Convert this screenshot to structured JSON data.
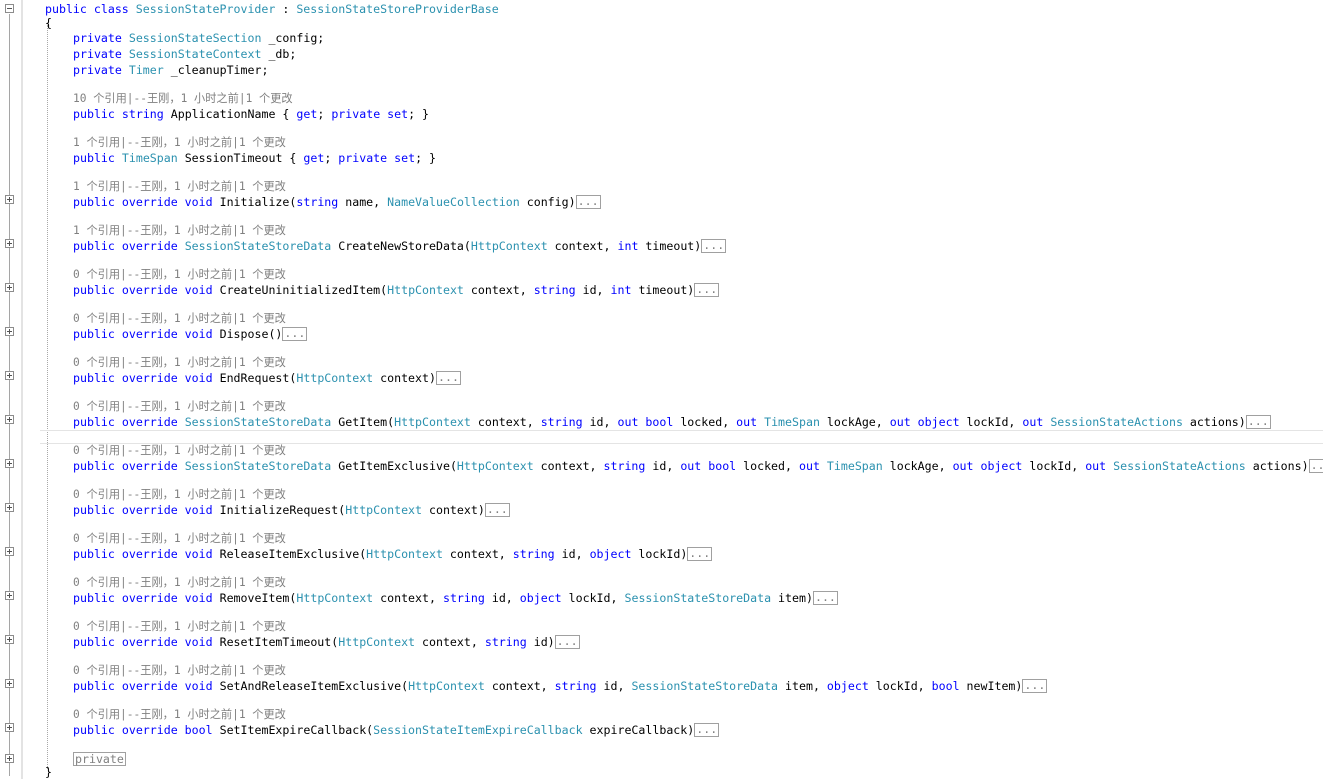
{
  "code": {
    "class_decl": {
      "kw1": "public",
      "kw2": "class",
      "name": "SessionStateProvider",
      "sep": " : ",
      "base": "SessionStateStoreProviderBase"
    },
    "open_brace": "{",
    "close_brace": "}",
    "fields": [
      {
        "kw": "private",
        "type": "SessionStateSection",
        "name": " _config;"
      },
      {
        "kw": "private",
        "type": "SessionStateContext",
        "name": " _db;"
      },
      {
        "kw": "private",
        "type": "Timer",
        "name": " _cleanupTimer;"
      }
    ],
    "lens": {
      "sep1": " 个引用|--",
      "author": "王刚",
      "comma": "，",
      "time": "1 小时之前",
      "bar": "|",
      "changes": "1 个更改"
    },
    "members": [
      {
        "refs": "10",
        "sig": [
          [
            "kw",
            "public "
          ],
          [
            "kw",
            "string"
          ],
          [
            "t",
            " ApplicationName { "
          ],
          [
            "kw",
            "get"
          ],
          [
            "t",
            "; "
          ],
          [
            "kw",
            "private set"
          ],
          [
            "t",
            "; }"
          ]
        ],
        "collapsed": false
      },
      {
        "refs": "1",
        "sig": [
          [
            "kw",
            "public "
          ],
          [
            "ty",
            "TimeSpan"
          ],
          [
            "t",
            " SessionTimeout { "
          ],
          [
            "kw",
            "get"
          ],
          [
            "t",
            "; "
          ],
          [
            "kw",
            "private set"
          ],
          [
            "t",
            "; }"
          ]
        ],
        "collapsed": false
      },
      {
        "refs": "1",
        "sig": [
          [
            "kw",
            "public override void"
          ],
          [
            "t",
            " Initialize("
          ],
          [
            "kw",
            "string"
          ],
          [
            "t",
            " name, "
          ],
          [
            "ty",
            "NameValueCollection"
          ],
          [
            "t",
            " config)"
          ]
        ],
        "collapsed": true
      },
      {
        "refs": "1",
        "sig": [
          [
            "kw",
            "public override "
          ],
          [
            "ty",
            "SessionStateStoreData"
          ],
          [
            "t",
            " CreateNewStoreData("
          ],
          [
            "ty",
            "HttpContext"
          ],
          [
            "t",
            " context, "
          ],
          [
            "kw",
            "int"
          ],
          [
            "t",
            " timeout)"
          ]
        ],
        "collapsed": true
      },
      {
        "refs": "0",
        "sig": [
          [
            "kw",
            "public override void"
          ],
          [
            "t",
            " CreateUninitializedItem("
          ],
          [
            "ty",
            "HttpContext"
          ],
          [
            "t",
            " context, "
          ],
          [
            "kw",
            "string"
          ],
          [
            "t",
            " id, "
          ],
          [
            "kw",
            "int"
          ],
          [
            "t",
            " timeout)"
          ]
        ],
        "collapsed": true
      },
      {
        "refs": "0",
        "sig": [
          [
            "kw",
            "public override void"
          ],
          [
            "t",
            " Dispose()"
          ]
        ],
        "collapsed": true
      },
      {
        "refs": "0",
        "sig": [
          [
            "kw",
            "public override void"
          ],
          [
            "t",
            " EndRequest("
          ],
          [
            "ty",
            "HttpContext"
          ],
          [
            "t",
            " context)"
          ]
        ],
        "collapsed": true
      },
      {
        "refs": "0",
        "sig": [
          [
            "kw",
            "public override "
          ],
          [
            "ty",
            "SessionStateStoreData"
          ],
          [
            "t",
            " GetItem("
          ],
          [
            "ty",
            "HttpContext"
          ],
          [
            "t",
            " context, "
          ],
          [
            "kw",
            "string"
          ],
          [
            "t",
            " id, "
          ],
          [
            "kw",
            "out bool"
          ],
          [
            "t",
            " locked, "
          ],
          [
            "kw",
            "out "
          ],
          [
            "ty",
            "TimeSpan"
          ],
          [
            "t",
            " lockAge, "
          ],
          [
            "kw",
            "out object"
          ],
          [
            "t",
            " lockId, "
          ],
          [
            "kw",
            "out "
          ],
          [
            "ty",
            "SessionStateActions"
          ],
          [
            "t",
            " actions)"
          ]
        ],
        "collapsed": true
      },
      {
        "refs": "0",
        "sig": [
          [
            "kw",
            "public override "
          ],
          [
            "ty",
            "SessionStateStoreData"
          ],
          [
            "t",
            " GetItemExclusive("
          ],
          [
            "ty",
            "HttpContext"
          ],
          [
            "t",
            " context, "
          ],
          [
            "kw",
            "string"
          ],
          [
            "t",
            " id, "
          ],
          [
            "kw",
            "out bool"
          ],
          [
            "t",
            " locked, "
          ],
          [
            "kw",
            "out "
          ],
          [
            "ty",
            "TimeSpan"
          ],
          [
            "t",
            " lockAge, "
          ],
          [
            "kw",
            "out object"
          ],
          [
            "t",
            " lockId, "
          ],
          [
            "kw",
            "out "
          ],
          [
            "ty",
            "SessionStateActions"
          ],
          [
            "t",
            " actions)"
          ]
        ],
        "collapsed": true
      },
      {
        "refs": "0",
        "sig": [
          [
            "kw",
            "public override void"
          ],
          [
            "t",
            " InitializeRequest("
          ],
          [
            "ty",
            "HttpContext"
          ],
          [
            "t",
            " context)"
          ]
        ],
        "collapsed": true
      },
      {
        "refs": "0",
        "sig": [
          [
            "kw",
            "public override void"
          ],
          [
            "t",
            " ReleaseItemExclusive("
          ],
          [
            "ty",
            "HttpContext"
          ],
          [
            "t",
            " context, "
          ],
          [
            "kw",
            "string"
          ],
          [
            "t",
            " id, "
          ],
          [
            "kw",
            "object"
          ],
          [
            "t",
            " lockId)"
          ]
        ],
        "collapsed": true
      },
      {
        "refs": "0",
        "sig": [
          [
            "kw",
            "public override void"
          ],
          [
            "t",
            " RemoveItem("
          ],
          [
            "ty",
            "HttpContext"
          ],
          [
            "t",
            " context, "
          ],
          [
            "kw",
            "string"
          ],
          [
            "t",
            " id, "
          ],
          [
            "kw",
            "object"
          ],
          [
            "t",
            " lockId, "
          ],
          [
            "ty",
            "SessionStateStoreData"
          ],
          [
            "t",
            " item)"
          ]
        ],
        "collapsed": true
      },
      {
        "refs": "0",
        "sig": [
          [
            "kw",
            "public override void"
          ],
          [
            "t",
            " ResetItemTimeout("
          ],
          [
            "ty",
            "HttpContext"
          ],
          [
            "t",
            " context, "
          ],
          [
            "kw",
            "string"
          ],
          [
            "t",
            " id)"
          ]
        ],
        "collapsed": true
      },
      {
        "refs": "0",
        "sig": [
          [
            "kw",
            "public override void"
          ],
          [
            "t",
            " SetAndReleaseItemExclusive("
          ],
          [
            "ty",
            "HttpContext"
          ],
          [
            "t",
            " context, "
          ],
          [
            "kw",
            "string"
          ],
          [
            "t",
            " id, "
          ],
          [
            "ty",
            "SessionStateStoreData"
          ],
          [
            "t",
            " item, "
          ],
          [
            "kw",
            "object"
          ],
          [
            "t",
            " lockId, "
          ],
          [
            "kw",
            "bool"
          ],
          [
            "t",
            " newItem)"
          ]
        ],
        "collapsed": true
      },
      {
        "refs": "0",
        "sig": [
          [
            "kw",
            "public override bool"
          ],
          [
            "t",
            " SetItemExpireCallback("
          ],
          [
            "ty",
            "SessionStateItemExpireCallback"
          ],
          [
            "t",
            " expireCallback)"
          ]
        ],
        "collapsed": true
      }
    ],
    "ellipsis": "...",
    "region_label": "private"
  },
  "colors": {
    "keyword": "#0000ff",
    "type": "#2b91af",
    "lens": "#808080"
  }
}
